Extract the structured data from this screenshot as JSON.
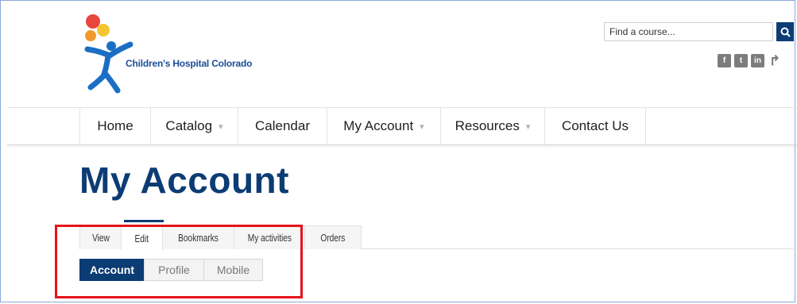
{
  "header": {
    "brand_name": "Children's Hospital Colorado",
    "search": {
      "placeholder": "Find a course..."
    },
    "social": [
      {
        "icon": "facebook-icon",
        "glyph": "f"
      },
      {
        "icon": "twitter-icon",
        "glyph": "t"
      },
      {
        "icon": "linkedin-icon",
        "glyph": "in"
      },
      {
        "icon": "share-icon",
        "glyph": "↱"
      }
    ]
  },
  "nav": {
    "items": [
      {
        "label": "Home",
        "has_dropdown": false
      },
      {
        "label": "Catalog",
        "has_dropdown": true
      },
      {
        "label": "Calendar",
        "has_dropdown": false
      },
      {
        "label": "My Account",
        "has_dropdown": true
      },
      {
        "label": "Resources",
        "has_dropdown": true
      },
      {
        "label": "Contact Us",
        "has_dropdown": false
      }
    ]
  },
  "page": {
    "title": "My Account",
    "tabs": [
      {
        "label": "View",
        "active": false
      },
      {
        "label": "Edit",
        "active": true
      },
      {
        "label": "Bookmarks",
        "active": false
      },
      {
        "label": "My activities",
        "active": false
      },
      {
        "label": "Orders",
        "active": false
      }
    ],
    "subtabs": [
      {
        "label": "Account",
        "active": true
      },
      {
        "label": "Profile",
        "active": false
      },
      {
        "label": "Mobile",
        "active": false
      }
    ]
  },
  "colors": {
    "brand_navy": "#0c3c74",
    "highlight_red": "#e5131b",
    "logo_blue": "#1a6fc4"
  }
}
